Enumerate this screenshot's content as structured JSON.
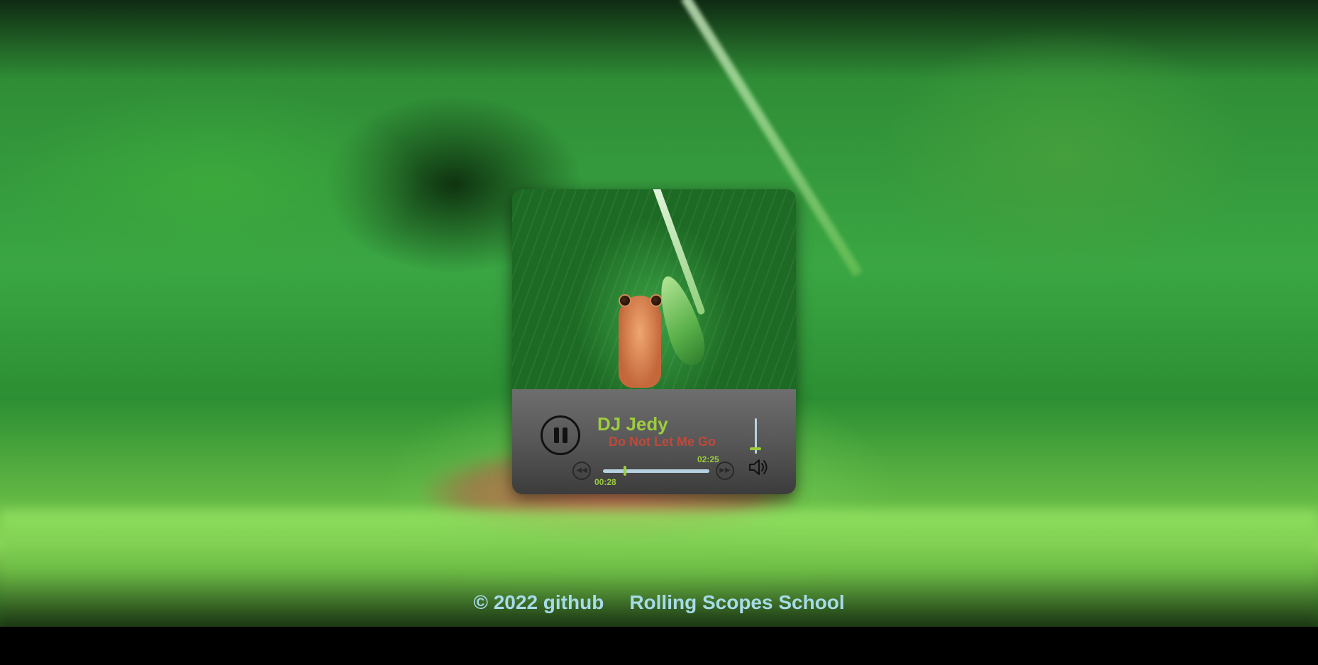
{
  "player": {
    "artist": "DJ Jedy",
    "track": "Do Not Let Me Go",
    "current_time": "00:28",
    "duration": "02:25",
    "progress_fraction": 0.19,
    "volume_fraction": 0.1,
    "state": "playing",
    "colors": {
      "accent": "#9ccd3c",
      "track_title": "#c0493a",
      "bar": "#b7d2e0"
    }
  },
  "icons": {
    "play_pause": "pause-icon",
    "prev": "rewind-icon",
    "next": "fast-forward-icon",
    "volume": "speaker-icon"
  },
  "footer": {
    "copyright": "© 2022 github",
    "school": "Rolling Scopes School"
  }
}
